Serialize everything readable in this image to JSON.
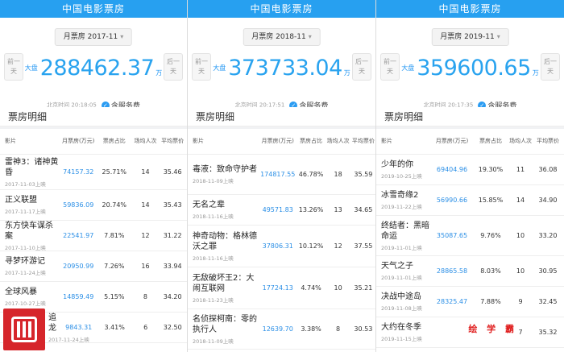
{
  "panels": [
    {
      "header_title": "中国电影票房",
      "month_label": "月票房 2017-11",
      "prev_label": "前一天",
      "next_label": "后一天",
      "total_label": "大盘",
      "total_value": "288462.37",
      "total_unit": "万",
      "time_text": "北京时间 20:18:05",
      "fee_label": "含服务费",
      "section_title": "票房明细",
      "columns": [
        "影片",
        "月票房(万元)",
        "票房占比",
        "场均人次",
        "平均票价"
      ],
      "rows": [
        {
          "title": "雷神3：诸神黄昏",
          "date": "2017-11-03上映",
          "box": "74157.32",
          "share": "25.71%",
          "shows": "14",
          "price": "35.46"
        },
        {
          "title": "正义联盟",
          "date": "2017-11-17上映",
          "box": "59836.09",
          "share": "20.74%",
          "shows": "14",
          "price": "35.43"
        },
        {
          "title": "东方快车谋杀案",
          "date": "2017-11-10上映",
          "box": "22541.97",
          "share": "7.81%",
          "shows": "12",
          "price": "31.22"
        },
        {
          "title": "寻梦环游记",
          "date": "2017-11-24上映",
          "box": "20950.99",
          "share": "7.26%",
          "shows": "16",
          "price": "33.94"
        },
        {
          "title": "全球风暴",
          "date": "2017-10-27上映",
          "box": "14859.49",
          "share": "5.15%",
          "shows": "8",
          "price": "34.20"
        },
        {
          "title": "追龙",
          "date": "2017-11-24上映",
          "box": "9843.31",
          "share": "3.41%",
          "shows": "6",
          "price": "32.50"
        }
      ]
    },
    {
      "header_title": "中国电影票房",
      "month_label": "月票房 2018-11",
      "prev_label": "前一天",
      "next_label": "后一天",
      "total_label": "大盘",
      "total_value": "373733.04",
      "total_unit": "万",
      "time_text": "北京时间 20:17:51",
      "fee_label": "含服务费",
      "section_title": "票房明细",
      "columns": [
        "影片",
        "月票房(万元)",
        "票房占比",
        "场均人次",
        "平均票价"
      ],
      "rows": [
        {
          "title": "毒液：致命守护者",
          "date": "2018-11-09上映",
          "box": "174817.55",
          "share": "46.78%",
          "shows": "18",
          "price": "35.59"
        },
        {
          "title": "无名之辈",
          "date": "2018-11-16上映",
          "box": "49571.83",
          "share": "13.26%",
          "shows": "13",
          "price": "34.65"
        },
        {
          "title": "神奇动物：格林德沃之罪",
          "date": "2018-11-16上映",
          "box": "37806.31",
          "share": "10.12%",
          "shows": "12",
          "price": "37.55"
        },
        {
          "title": "无敌破坏王2：大闹互联网",
          "date": "2018-11-23上映",
          "box": "17724.13",
          "share": "4.74%",
          "shows": "10",
          "price": "35.21"
        },
        {
          "title": "名侦探柯南：零的执行人",
          "date": "2018-11-09上映",
          "box": "12639.70",
          "share": "3.38%",
          "shows": "8",
          "price": "30.53"
        }
      ]
    },
    {
      "header_title": "中国电影票房",
      "month_label": "月票房 2019-11",
      "prev_label": "前一天",
      "next_label": "后一天",
      "total_label": "大盘",
      "total_value": "359600.65",
      "total_unit": "万",
      "time_text": "北京时间 20:17:35",
      "fee_label": "含服务费",
      "section_title": "票房明细",
      "columns": [
        "影片",
        "月票房(万元)",
        "票房占比",
        "场均人次",
        "平均票价"
      ],
      "rows": [
        {
          "title": "少年的你",
          "date": "2019-10-25上映",
          "box": "69404.96",
          "share": "19.30%",
          "shows": "11",
          "price": "36.08"
        },
        {
          "title": "冰雪奇缘2",
          "date": "2019-11-22上映",
          "box": "56990.66",
          "share": "15.85%",
          "shows": "14",
          "price": "34.90"
        },
        {
          "title": "终结者：黑暗命运",
          "date": "2019-11-01上映",
          "box": "35087.65",
          "share": "9.76%",
          "shows": "10",
          "price": "33.20"
        },
        {
          "title": "天气之子",
          "date": "2019-11-01上映",
          "box": "28865.58",
          "share": "8.03%",
          "shows": "10",
          "price": "30.95"
        },
        {
          "title": "决战中途岛",
          "date": "2019-11-08上映",
          "box": "28325.47",
          "share": "7.88%",
          "shows": "9",
          "price": "32.45"
        },
        {
          "title": "大约在冬季",
          "date": "2019-11-15上映",
          "box": "",
          "share": "",
          "shows": "7",
          "price": "35.32"
        }
      ]
    }
  ],
  "watermark": "绘 学 霸",
  "colors": {
    "header": "#27a0f0",
    "accent": "#29a3ef",
    "logo": "#d6262b"
  }
}
